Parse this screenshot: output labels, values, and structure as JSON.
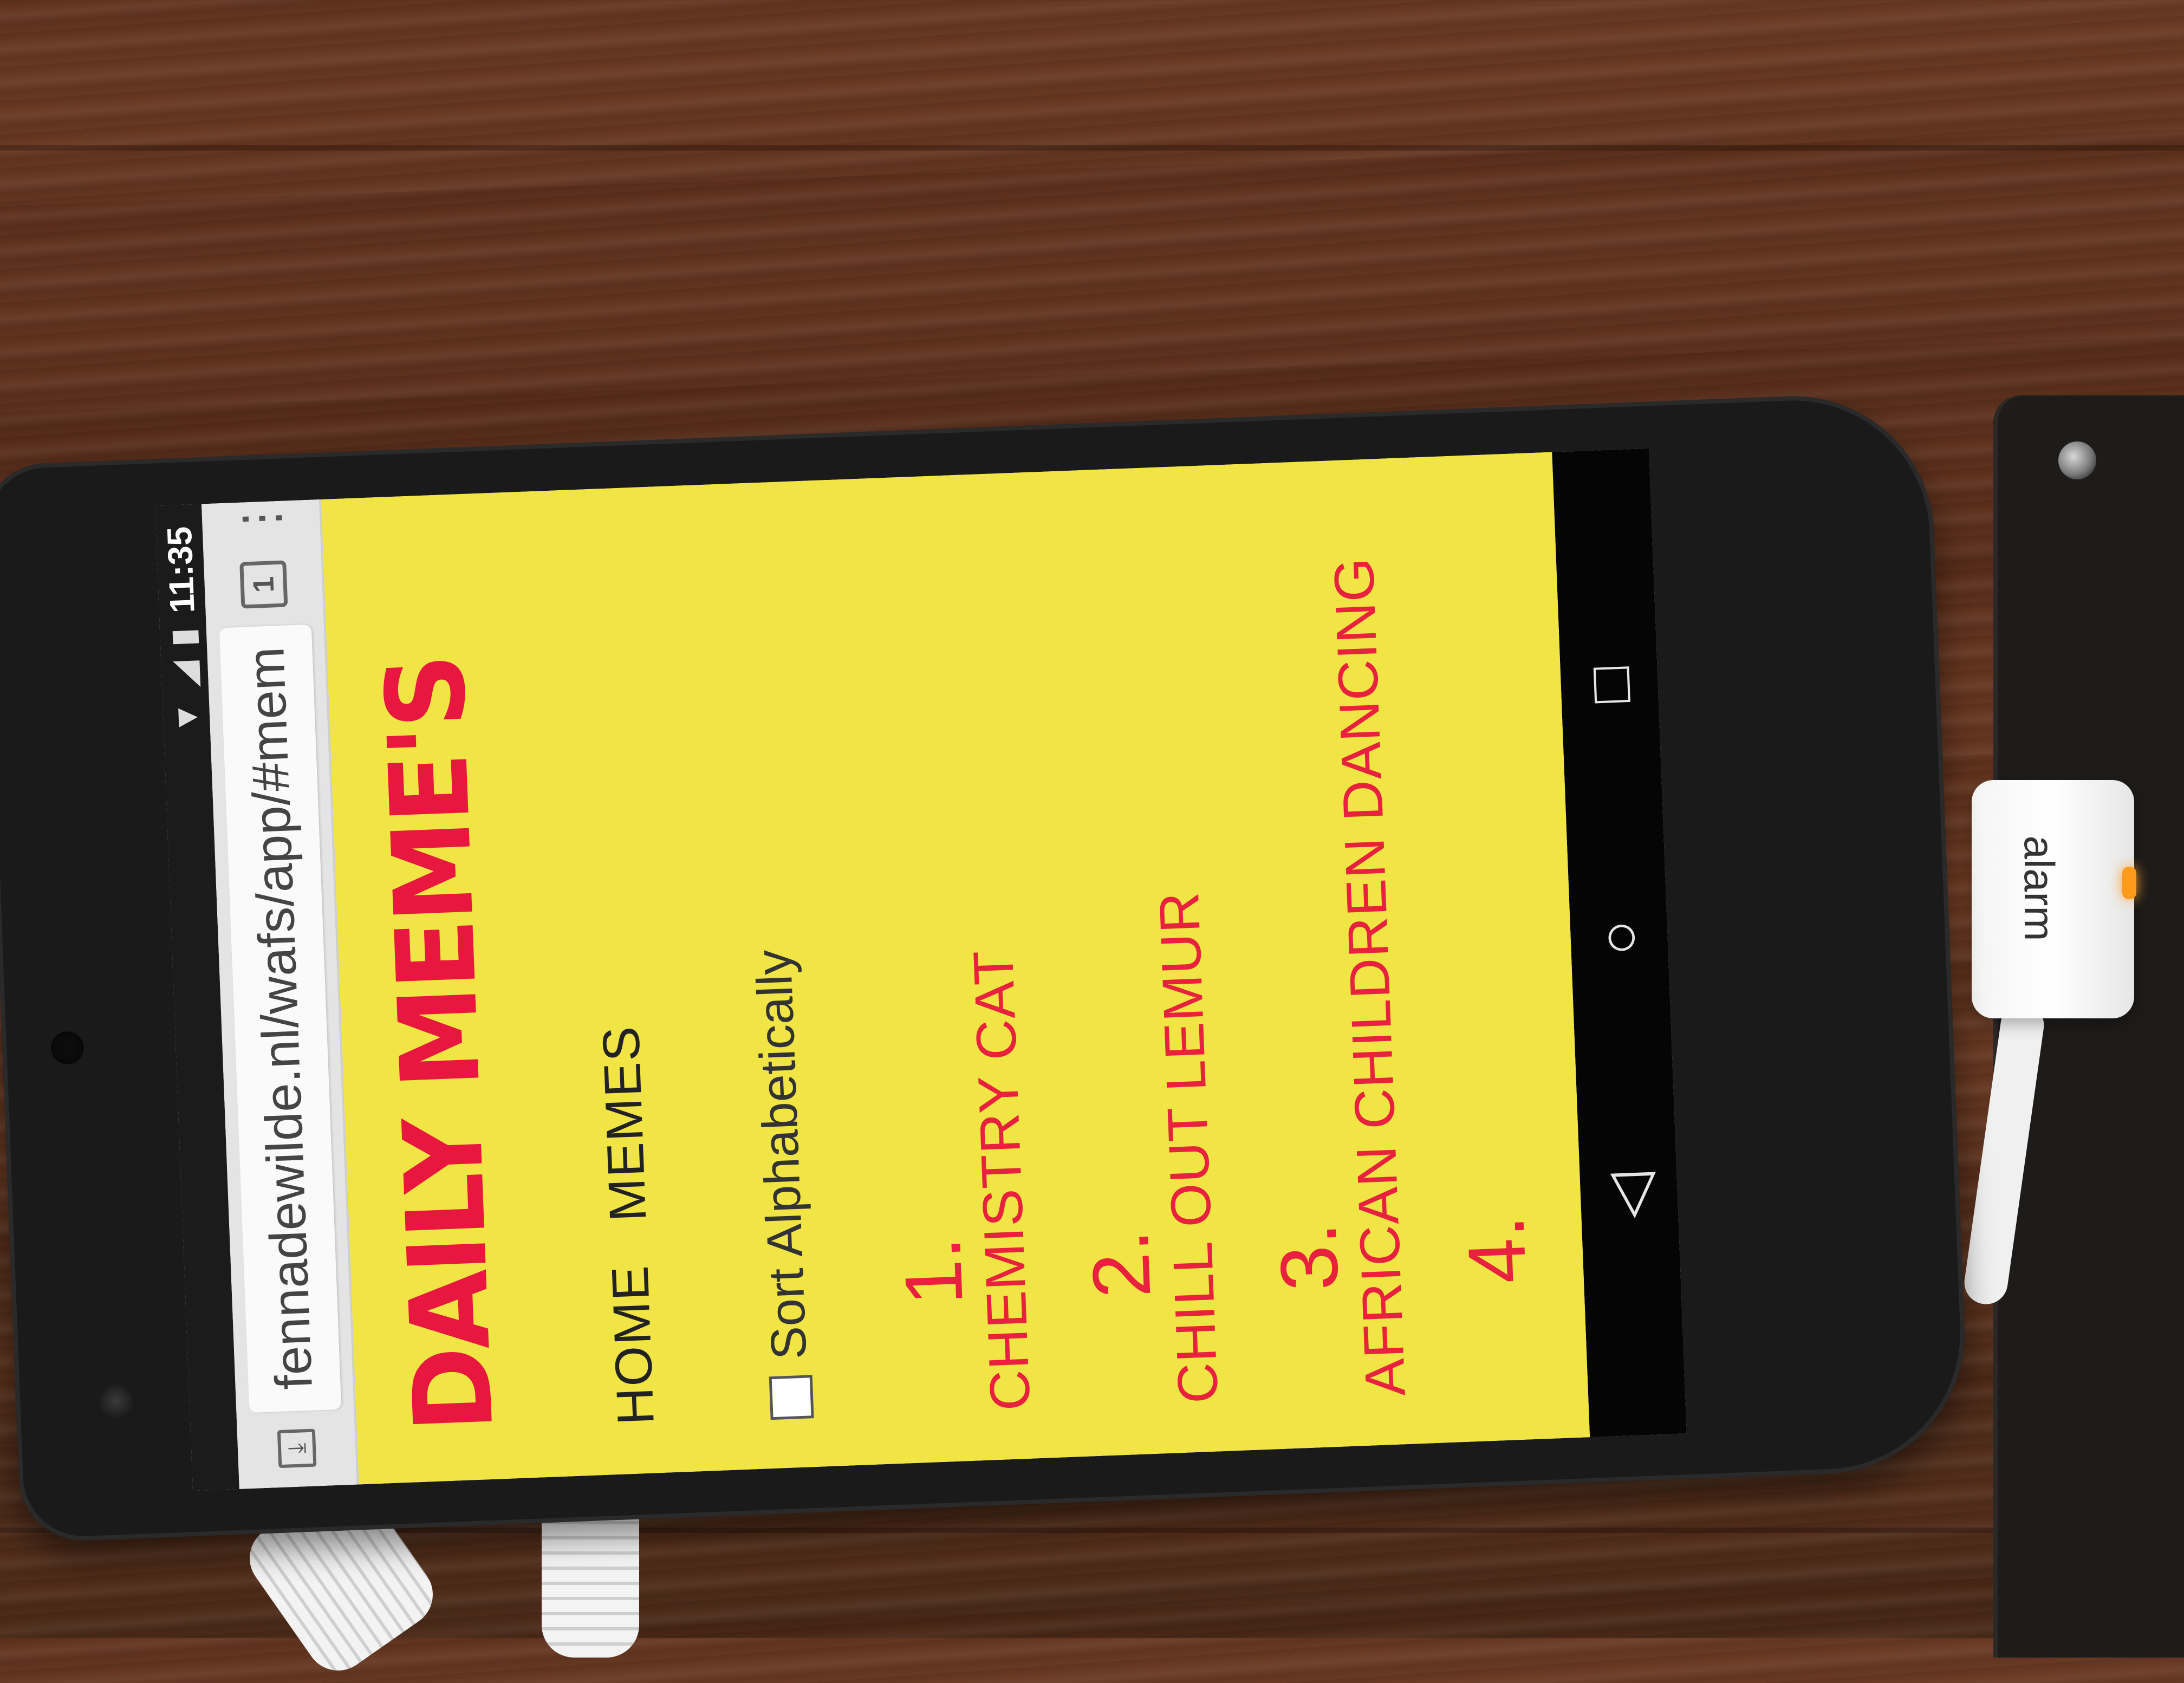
{
  "status_bar": {
    "time": "11:35"
  },
  "browser": {
    "url": "fennadewilde.nl/wafs/app/#mem",
    "tab_count": "1"
  },
  "page": {
    "logo": "DAILY MEME'S",
    "nav": [
      "HOME",
      "MEMES"
    ],
    "sort_label": "Sort Alphabetically",
    "sort_checked": false,
    "memes": [
      {
        "number": "1.",
        "title": "CHEMISTRY CAT"
      },
      {
        "number": "2.",
        "title": "CHILL OUT LEMUR"
      },
      {
        "number": "3.",
        "title": "AFRICAN CHILDREN DANCING"
      },
      {
        "number": "4.",
        "title": ""
      }
    ]
  },
  "device": {
    "alarm_label": "alarm"
  },
  "colors": {
    "page_bg": "#f1e445",
    "accent": "#e8213f"
  },
  "icons": [
    "wifi-icon",
    "signal-icon",
    "battery-icon",
    "download-icon",
    "tabs-icon",
    "overflow-menu-icon",
    "back-icon",
    "home-icon",
    "recents-icon"
  ]
}
